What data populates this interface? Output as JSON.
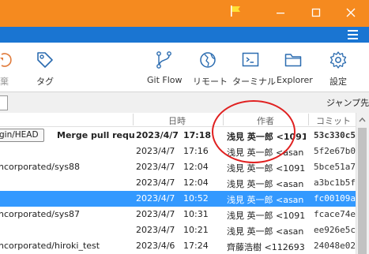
{
  "toolbar": {
    "items": [
      {
        "label": "棄",
        "icon": "discard-icon"
      },
      {
        "label": "タグ",
        "icon": "tag-icon"
      },
      {
        "label": "Git Flow",
        "icon": "git-flow-icon"
      },
      {
        "label": "リモート",
        "icon": "globe-icon"
      },
      {
        "label": "ターミナル",
        "icon": "terminal-icon"
      },
      {
        "label": "Explorer",
        "icon": "folder-icon"
      },
      {
        "label": "設定",
        "icon": "gear-icon"
      }
    ]
  },
  "filter": {
    "jump_label": "ジャンプ先:"
  },
  "columns": {
    "date": "日時",
    "author": "作者",
    "commit": "コミット"
  },
  "rows": [
    {
      "branch_tag": "gin/HEAD",
      "message": "Merge pull requ",
      "date": "2023/4/7",
      "time": "17:18",
      "author": "浅見 英一郎 <1091",
      "hash": "53c330c5",
      "bold": true,
      "selected": false
    },
    {
      "branch_tag": "",
      "message": "",
      "date": "2023/4/7",
      "time": "17:16",
      "author": "浅見 英一郎 <asan",
      "hash": "5f2e67b0",
      "bold": false,
      "selected": false
    },
    {
      "branch_tag": "",
      "message": "ncorporated/sys88",
      "date": "2023/4/7",
      "time": "12:04",
      "author": "浅見 英一郎 <1091",
      "hash": "5bce51a7",
      "bold": false,
      "selected": false
    },
    {
      "branch_tag": "",
      "message": "",
      "date": "2023/4/7",
      "time": "12:04",
      "author": "浅見 英一郎 <asan",
      "hash": "a3bc1b5f",
      "bold": false,
      "selected": false
    },
    {
      "branch_tag": "",
      "message": "",
      "date": "2023/4/7",
      "time": "10:52",
      "author": "浅見 英一郎 <asan",
      "hash": "fc00109a",
      "bold": false,
      "selected": true
    },
    {
      "branch_tag": "",
      "message": "ncorporated/sys87",
      "date": "2023/4/7",
      "time": "10:31",
      "author": "浅見 英一郎 <1091",
      "hash": "fcace74e",
      "bold": false,
      "selected": false
    },
    {
      "branch_tag": "",
      "message": "",
      "date": "2023/4/7",
      "time": "10:21",
      "author": "浅見 英一郎 <asan",
      "hash": "ee926e5c",
      "bold": false,
      "selected": false
    },
    {
      "branch_tag": "",
      "message": "ncorporated/hiroki_test",
      "date": "2023/4/6",
      "time": "17:24",
      "author": "齊藤浩樹 <112693",
      "hash": "24048e02",
      "bold": false,
      "selected": false
    }
  ],
  "colors": {
    "titlebar": "#f58a1f",
    "menustrip": "#1a75d2",
    "selection": "#3399ff",
    "annotation_circle": "#e02020"
  }
}
